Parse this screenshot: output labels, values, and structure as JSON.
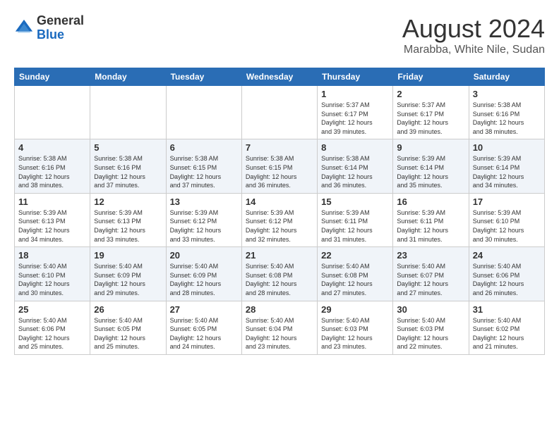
{
  "header": {
    "logo": {
      "general": "General",
      "blue": "Blue"
    },
    "title": "August 2024",
    "location": "Marabba, White Nile, Sudan"
  },
  "days_of_week": [
    "Sunday",
    "Monday",
    "Tuesday",
    "Wednesday",
    "Thursday",
    "Friday",
    "Saturday"
  ],
  "weeks": [
    [
      {
        "day": "",
        "content": ""
      },
      {
        "day": "",
        "content": ""
      },
      {
        "day": "",
        "content": ""
      },
      {
        "day": "",
        "content": ""
      },
      {
        "day": "1",
        "content": "Sunrise: 5:37 AM\nSunset: 6:17 PM\nDaylight: 12 hours\nand 39 minutes."
      },
      {
        "day": "2",
        "content": "Sunrise: 5:37 AM\nSunset: 6:17 PM\nDaylight: 12 hours\nand 39 minutes."
      },
      {
        "day": "3",
        "content": "Sunrise: 5:38 AM\nSunset: 6:16 PM\nDaylight: 12 hours\nand 38 minutes."
      }
    ],
    [
      {
        "day": "4",
        "content": "Sunrise: 5:38 AM\nSunset: 6:16 PM\nDaylight: 12 hours\nand 38 minutes."
      },
      {
        "day": "5",
        "content": "Sunrise: 5:38 AM\nSunset: 6:16 PM\nDaylight: 12 hours\nand 37 minutes."
      },
      {
        "day": "6",
        "content": "Sunrise: 5:38 AM\nSunset: 6:15 PM\nDaylight: 12 hours\nand 37 minutes."
      },
      {
        "day": "7",
        "content": "Sunrise: 5:38 AM\nSunset: 6:15 PM\nDaylight: 12 hours\nand 36 minutes."
      },
      {
        "day": "8",
        "content": "Sunrise: 5:38 AM\nSunset: 6:14 PM\nDaylight: 12 hours\nand 36 minutes."
      },
      {
        "day": "9",
        "content": "Sunrise: 5:39 AM\nSunset: 6:14 PM\nDaylight: 12 hours\nand 35 minutes."
      },
      {
        "day": "10",
        "content": "Sunrise: 5:39 AM\nSunset: 6:14 PM\nDaylight: 12 hours\nand 34 minutes."
      }
    ],
    [
      {
        "day": "11",
        "content": "Sunrise: 5:39 AM\nSunset: 6:13 PM\nDaylight: 12 hours\nand 34 minutes."
      },
      {
        "day": "12",
        "content": "Sunrise: 5:39 AM\nSunset: 6:13 PM\nDaylight: 12 hours\nand 33 minutes."
      },
      {
        "day": "13",
        "content": "Sunrise: 5:39 AM\nSunset: 6:12 PM\nDaylight: 12 hours\nand 33 minutes."
      },
      {
        "day": "14",
        "content": "Sunrise: 5:39 AM\nSunset: 6:12 PM\nDaylight: 12 hours\nand 32 minutes."
      },
      {
        "day": "15",
        "content": "Sunrise: 5:39 AM\nSunset: 6:11 PM\nDaylight: 12 hours\nand 31 minutes."
      },
      {
        "day": "16",
        "content": "Sunrise: 5:39 AM\nSunset: 6:11 PM\nDaylight: 12 hours\nand 31 minutes."
      },
      {
        "day": "17",
        "content": "Sunrise: 5:39 AM\nSunset: 6:10 PM\nDaylight: 12 hours\nand 30 minutes."
      }
    ],
    [
      {
        "day": "18",
        "content": "Sunrise: 5:40 AM\nSunset: 6:10 PM\nDaylight: 12 hours\nand 30 minutes."
      },
      {
        "day": "19",
        "content": "Sunrise: 5:40 AM\nSunset: 6:09 PM\nDaylight: 12 hours\nand 29 minutes."
      },
      {
        "day": "20",
        "content": "Sunrise: 5:40 AM\nSunset: 6:09 PM\nDaylight: 12 hours\nand 28 minutes."
      },
      {
        "day": "21",
        "content": "Sunrise: 5:40 AM\nSunset: 6:08 PM\nDaylight: 12 hours\nand 28 minutes."
      },
      {
        "day": "22",
        "content": "Sunrise: 5:40 AM\nSunset: 6:08 PM\nDaylight: 12 hours\nand 27 minutes."
      },
      {
        "day": "23",
        "content": "Sunrise: 5:40 AM\nSunset: 6:07 PM\nDaylight: 12 hours\nand 27 minutes."
      },
      {
        "day": "24",
        "content": "Sunrise: 5:40 AM\nSunset: 6:06 PM\nDaylight: 12 hours\nand 26 minutes."
      }
    ],
    [
      {
        "day": "25",
        "content": "Sunrise: 5:40 AM\nSunset: 6:06 PM\nDaylight: 12 hours\nand 25 minutes."
      },
      {
        "day": "26",
        "content": "Sunrise: 5:40 AM\nSunset: 6:05 PM\nDaylight: 12 hours\nand 25 minutes."
      },
      {
        "day": "27",
        "content": "Sunrise: 5:40 AM\nSunset: 6:05 PM\nDaylight: 12 hours\nand 24 minutes."
      },
      {
        "day": "28",
        "content": "Sunrise: 5:40 AM\nSunset: 6:04 PM\nDaylight: 12 hours\nand 23 minutes."
      },
      {
        "day": "29",
        "content": "Sunrise: 5:40 AM\nSunset: 6:03 PM\nDaylight: 12 hours\nand 23 minutes."
      },
      {
        "day": "30",
        "content": "Sunrise: 5:40 AM\nSunset: 6:03 PM\nDaylight: 12 hours\nand 22 minutes."
      },
      {
        "day": "31",
        "content": "Sunrise: 5:40 AM\nSunset: 6:02 PM\nDaylight: 12 hours\nand 21 minutes."
      }
    ]
  ]
}
